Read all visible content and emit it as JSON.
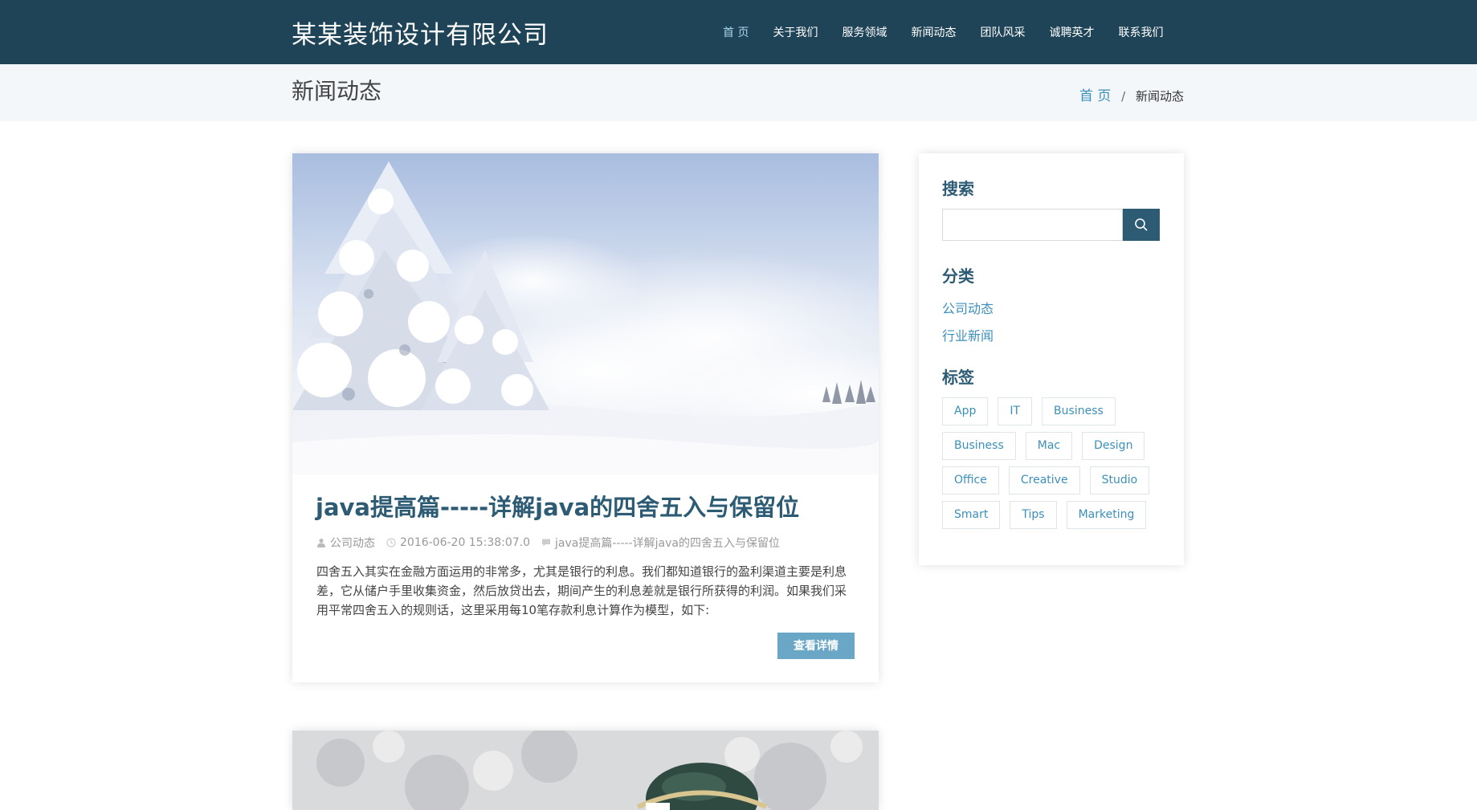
{
  "header": {
    "logo": "某某装饰设计有限公司",
    "nav": [
      {
        "label": "首 页",
        "active": true
      },
      {
        "label": "关于我们",
        "active": false
      },
      {
        "label": "服务领域",
        "active": false
      },
      {
        "label": "新闻动态",
        "active": false
      },
      {
        "label": "团队风采",
        "active": false
      },
      {
        "label": "诚聘英才",
        "active": false
      },
      {
        "label": "联系我们",
        "active": false
      }
    ]
  },
  "titlebar": {
    "title": "新闻动态",
    "breadcrumb": {
      "home": "首 页",
      "separator": "/",
      "current": "新闻动态"
    }
  },
  "post": {
    "title": "java提高篇-----详解java的四舍五入与保留位",
    "meta": {
      "category": "公司动态",
      "date": "2016-06-20 15:38:07.0",
      "comment": "java提高篇-----详解java的四舍五入与保留位"
    },
    "excerpt": "四舍五入其实在金融方面运用的非常多，尤其是银行的利息。我们都知道银行的盈利渠道主要是利息差，它从储户手里收集资金，然后放贷出去，期间产生的利息差就是银行所获得的利润。如果我们采用平常四舍五入的规则话，这里采用每10笔存款利息计算作为模型，如下:",
    "more_label": "查看详情"
  },
  "sidebar": {
    "search_heading": "搜索",
    "search_placeholder": "",
    "search_value": "",
    "category_heading": "分类",
    "categories": [
      "公司动态",
      "行业新闻"
    ],
    "tags_heading": "标签",
    "tag_rows": [
      [
        "App",
        "IT",
        "Business"
      ],
      [
        "Business",
        "Mac",
        "Design"
      ],
      [
        "Office",
        "Creative",
        "Studio"
      ],
      [
        "Smart",
        "Tips",
        "Marketing"
      ]
    ]
  },
  "colors": {
    "header_bg": "#1f4457",
    "accent": "#2d5b74",
    "link": "#3c8fb8",
    "button": "#6aa7c7",
    "titlebar_bg": "#f3f7fa"
  },
  "icons": {
    "meta_category": "user-icon",
    "meta_date": "clock-icon",
    "meta_comment": "comment-icon",
    "search": "search-icon"
  }
}
